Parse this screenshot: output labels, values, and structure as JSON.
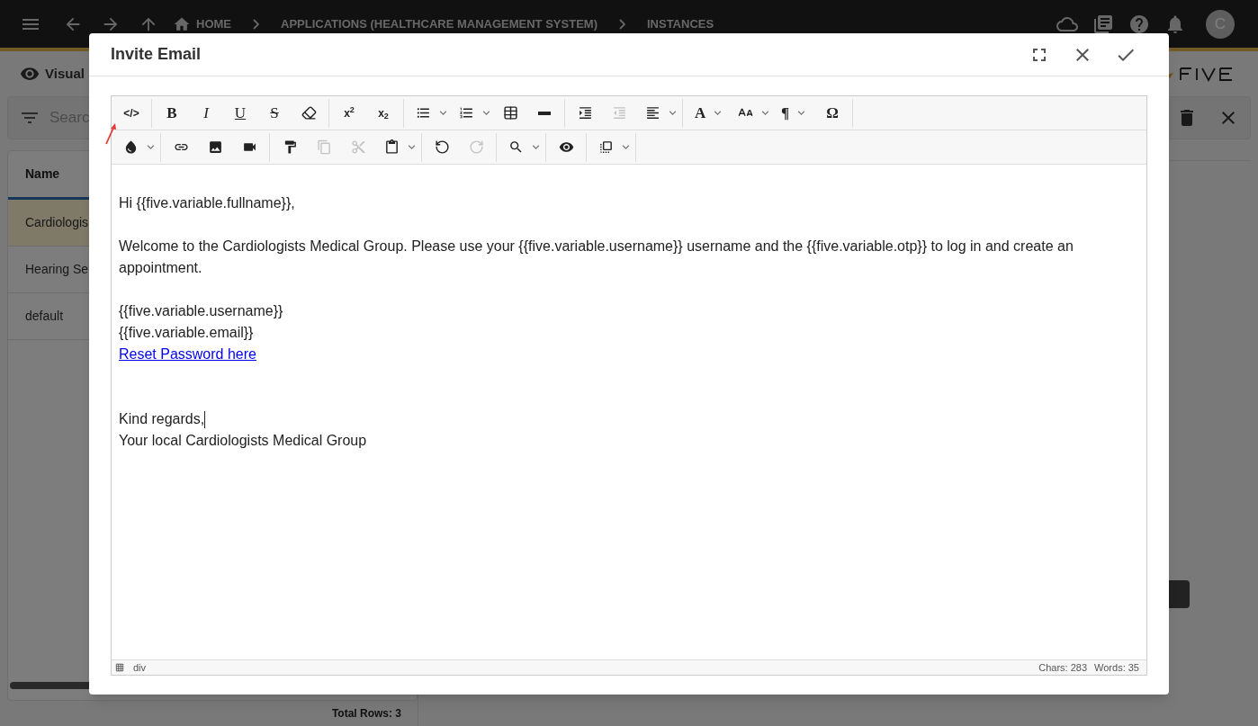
{
  "top_bar": {
    "breadcrumbs": [
      {
        "label": "HOME",
        "home": true
      },
      {
        "label": "APPLICATIONS (HEALTHCARE MANAGEMENT SYSTEM)",
        "home": false
      },
      {
        "label": "INSTANCES",
        "home": false
      }
    ],
    "avatar": "C"
  },
  "left_panel": {
    "view_label": "Visual",
    "search": {
      "placeholder": "Searc"
    },
    "table": {
      "columns": [
        "Name"
      ],
      "rows": [
        {
          "name": "Cardiologis",
          "selected": true
        },
        {
          "name": "Hearing Se",
          "selected": false
        },
        {
          "name": "default",
          "selected": false
        }
      ]
    },
    "total": "Total Rows: 3"
  },
  "dialog": {
    "title": "Invite Email",
    "toolbar": {
      "rows": [
        [
          [
            {
              "kind": "plain",
              "glyph": "</>",
              "dropdown": false,
              "disabled": false
            }
          ],
          [
            {
              "kind": "bold",
              "glyph": "B",
              "dropdown": false,
              "disabled": false
            },
            {
              "kind": "italic",
              "glyph": "I",
              "dropdown": false,
              "disabled": false
            },
            {
              "kind": "underline",
              "glyph": "U",
              "dropdown": false,
              "disabled": false
            },
            {
              "kind": "strike",
              "glyph": "S",
              "dropdown": false,
              "disabled": false
            },
            {
              "kind": "icon",
              "dropdown": false,
              "disabled": false
            }
          ],
          [
            {
              "kind": "plain",
              "glyph": "x$^{2}$",
              "dropdown": false,
              "disabled": false
            },
            {
              "kind": "plain",
              "glyph": "x$_{2}$",
              "dropdown": false,
              "disabled": false
            }
          ],
          [
            {
              "kind": "icon",
              "dropdown": true,
              "disabled": false
            },
            {
              "kind": "icon",
              "dropdown": true,
              "disabled": false
            },
            {
              "kind": "icon",
              "dropdown": false,
              "disabled": false
            },
            {
              "kind": "icon",
              "dropdown": false,
              "disabled": false
            }
          ],
          [
            {
              "kind": "icon",
              "dropdown": false,
              "disabled": false
            },
            {
              "kind": "icon",
              "dropdown": false,
              "disabled": true
            },
            {
              "kind": "icon",
              "dropdown": true,
              "disabled": false
            }
          ],
          [
            {
              "kind": "bold",
              "glyph": "A",
              "dropdown": true,
              "disabled": false
            },
            {
              "kind": "icon",
              "dropdown": true,
              "disabled": false
            },
            {
              "kind": "bold",
              "glyph": "¶",
              "dropdown": true,
              "disabled": false
            },
            {
              "kind": "bold",
              "glyph": "Ω",
              "dropdown": false,
              "disabled": false
            }
          ]
        ],
        [
          [
            {
              "kind": "icon",
              "dropdown": true,
              "disabled": false
            }
          ],
          [
            {
              "kind": "icon",
              "dropdown": false,
              "disabled": false
            },
            {
              "kind": "icon",
              "dropdown": false,
              "disabled": false
            },
            {
              "kind": "icon",
              "dropdown": false,
              "disabled": false
            }
          ],
          [
            {
              "kind": "icon",
              "dropdown": false,
              "disabled": false
            },
            {
              "kind": "icon",
              "dropdown": false,
              "disabled": true
            },
            {
              "kind": "icon",
              "dropdown": false,
              "disabled": true
            },
            {
              "kind": "icon",
              "dropdown": true,
              "disabled": false
            }
          ],
          [
            {
              "kind": "icon",
              "dropdown": false,
              "disabled": false
            },
            {
              "kind": "icon",
              "dropdown": false,
              "disabled": true
            }
          ],
          [
            {
              "kind": "icon",
              "dropdown": true,
              "disabled": false
            }
          ],
          [
            {
              "kind": "icon",
              "dropdown": false,
              "disabled": false
            }
          ],
          [
            {
              "kind": "icon",
              "dropdown": true,
              "disabled": false
            }
          ]
        ]
      ]
    },
    "content": [
      {
        "kind": "empty"
      },
      {
        "kind": "paragraph",
        "lines": [
          {
            "kind": "text",
            "text": "Hi {{five.variable.fullname}},",
            "cursor": false
          }
        ]
      },
      {
        "kind": "empty"
      },
      {
        "kind": "paragraph",
        "lines": [
          {
            "kind": "text",
            "text": "Welcome to the Cardiologists Medical Group. Please use your {{five.variable.username}} username and the {{five.variable.otp}} to log in and create an appointment.",
            "cursor": false
          }
        ]
      },
      {
        "kind": "empty"
      },
      {
        "kind": "paragraph",
        "lines": [
          {
            "kind": "text",
            "text": "{{five.variable.username}}",
            "cursor": false
          },
          {
            "kind": "text",
            "text": "{{five.variable.email}}",
            "cursor": false
          },
          {
            "kind": "link",
            "text": "Reset Password here",
            "cursor": false
          }
        ]
      },
      {
        "kind": "empty"
      },
      {
        "kind": "empty"
      },
      {
        "kind": "paragraph",
        "lines": [
          {
            "kind": "text",
            "text": "Kind regards,",
            "cursor": true
          },
          {
            "kind": "text",
            "text": "Your local Cardiologists Medical Group",
            "cursor": false
          }
        ]
      }
    ],
    "status": {
      "path": "div",
      "chars": "Chars: 283",
      "words": "Words: 35"
    }
  }
}
